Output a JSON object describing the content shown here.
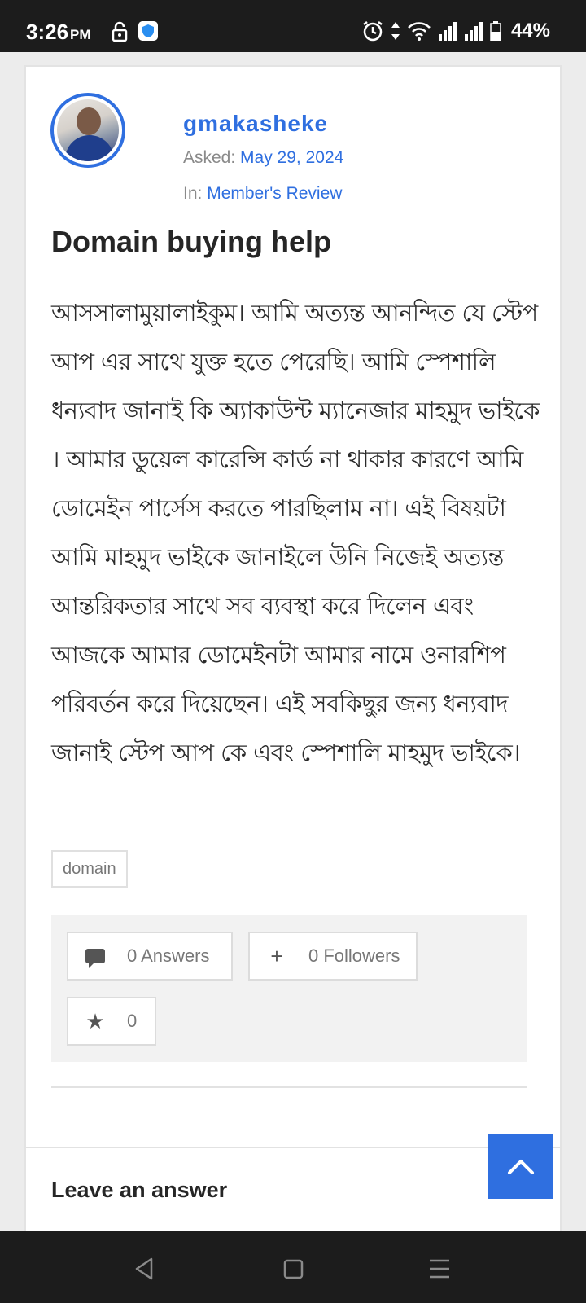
{
  "status_bar": {
    "time": "3:26",
    "ampm": "PM",
    "battery": "44%",
    "icons": [
      "lock-icon",
      "shield-app-icon",
      "alarm-icon",
      "data-arrows-icon",
      "wifi-icon",
      "signal-icon",
      "signal-icon-2",
      "battery-icon"
    ]
  },
  "question": {
    "author": "gmakasheke",
    "asked_label": "Asked:",
    "asked_date": "May 29, 2024",
    "in_label": "In:",
    "category": "Member's Review",
    "title": "Domain buying help",
    "body": "আসসালামুয়ালাইকুম। আমি অত্যন্ত আনন্দিত যে স্টেপ আপ এর সাথে যুক্ত হতে পেরেছি। আমি স্পেশালি ধন্যবাদ জানাই  কি অ্যাকাউন্ট ম্যানেজার মাহমুদ ভাইকে । আমার ডুয়েল কারেন্সি কার্ড না থাকার কারণে আমি ডোমেইন পার্সেস করতে পারছিলাম না। এই বিষয়টা আমি মাহমুদ ভাইকে জানাইলে উনি নিজেই অত্যন্ত আন্তরিকতার সাথে সব ব্যবস্থা করে দিলেন এবং আজকে আমার ডোমেইনটা আমার নামে ওনারশিপ পরিবর্তন করে দিয়েছেন। এই সবকিছুর জন্য ধন্যবাদ জানাই স্টেপ আপ কে এবং স্পেশালি মাহমুদ ভাইকে।",
    "tag": "domain",
    "answers": "0 Answers",
    "followers": "0 Followers",
    "favorites": "0"
  },
  "leave_answer_heading": "Leave an answer"
}
